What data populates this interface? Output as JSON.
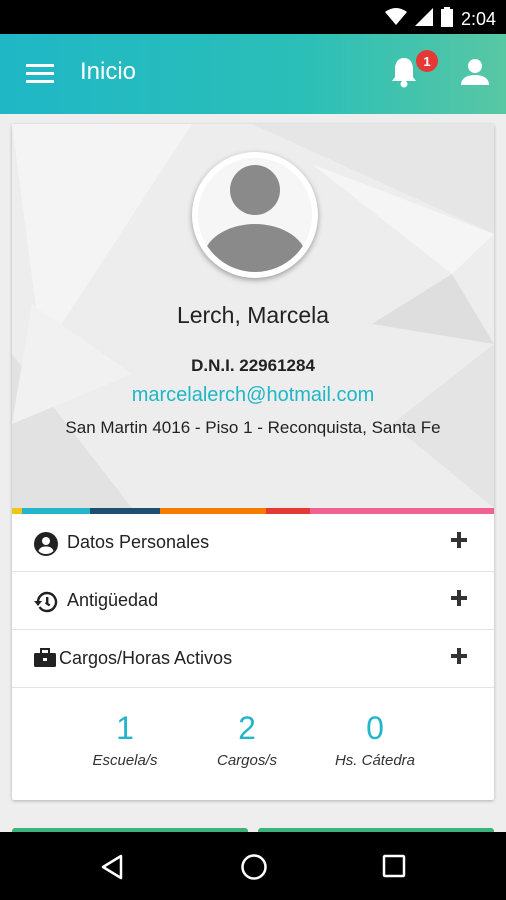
{
  "status_bar": {
    "time": "2:04"
  },
  "app_bar": {
    "title": "Inicio",
    "notification_count": "1"
  },
  "profile": {
    "name": "Lerch, Marcela",
    "dni": "D.N.I. 22961284",
    "email": "marcelalerch@hotmail.com",
    "address": "San Martin 4016 - Piso 1 - Reconquista, Santa Fe"
  },
  "color_strip": [
    "#f0c419",
    "#22b6c8",
    "#1e4f6e",
    "#1e4f6e",
    "#f57c00",
    "#e53935",
    "#f06292"
  ],
  "sections": [
    {
      "label": "Datos Personales",
      "icon": "account-circle-icon"
    },
    {
      "label": "Antigüedad",
      "icon": "history-icon"
    },
    {
      "label": "Cargos/Horas Activos",
      "icon": "briefcase-icon"
    }
  ],
  "stats": [
    {
      "value": "1",
      "label": "Escuela/s"
    },
    {
      "value": "2",
      "label": "Cargos/s"
    },
    {
      "value": "0",
      "label": "Hs. Cátedra"
    }
  ],
  "colors": {
    "accent": "#22b6c8",
    "badge": "#e53935"
  }
}
